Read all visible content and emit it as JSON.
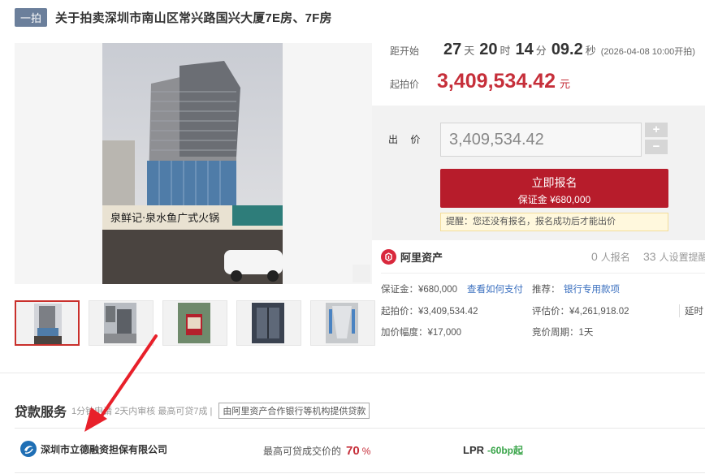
{
  "header": {
    "round_badge": "一拍",
    "title": "关于拍卖深圳市南山区常兴路国兴大厦7E房、7F房"
  },
  "countdown": {
    "label": "距开始",
    "days": "27",
    "days_unit": "天",
    "hours": "20",
    "hours_unit": "时",
    "minutes": "14",
    "minutes_unit": "分",
    "seconds": "09.2",
    "seconds_unit": "秒",
    "start_datetime": "(2026-04-08 10:00开拍)"
  },
  "start_price": {
    "label": "起拍价",
    "value": "3,409,534.42",
    "unit": "元"
  },
  "bid": {
    "label": "出 价",
    "input_value": "3,409,534.42",
    "plus": "+",
    "minus": "−",
    "register_button": "立即报名",
    "deposit_line": "保证金 ¥680,000",
    "tip": "提醒：您还没有报名，报名成功后才能出价"
  },
  "platform": {
    "name": "阿里资产",
    "registered_count": "0",
    "registered_label": "人报名",
    "reminder_count": "33",
    "reminder_label": "人设置提醒"
  },
  "info": {
    "deposit": "保证金：¥680,000",
    "deposit_link": "查看如何支付",
    "recommend_label": "推荐：",
    "recommend_link": "银行专用款项",
    "start_price": "起拍价：¥3,409,534.42",
    "appraisal": "评估价：¥4,261,918.02",
    "extension": "延时",
    "increment": "加价幅度：¥17,000",
    "bid_cycle": "竞价周期：1天"
  },
  "loan": {
    "title": "贷款服务",
    "subtitle": "1分钟申请 2天内审核 最高可贷7成 |",
    "tag": "由阿里资产合作银行等机构提供贷款",
    "company": "深圳市立德融资担保有限公司",
    "max_label": "最高可贷成交价的",
    "max_pct": "70",
    "max_pct_unit": "%",
    "lpr_label": "LPR",
    "lpr_value": "-60bp起"
  },
  "colors": {
    "accent_red": "#b71c2b",
    "price_red": "#c62f3a",
    "badge_blue": "#6b7f9b",
    "link_blue": "#3a6fbf",
    "lpr_green": "#3aa54a"
  }
}
